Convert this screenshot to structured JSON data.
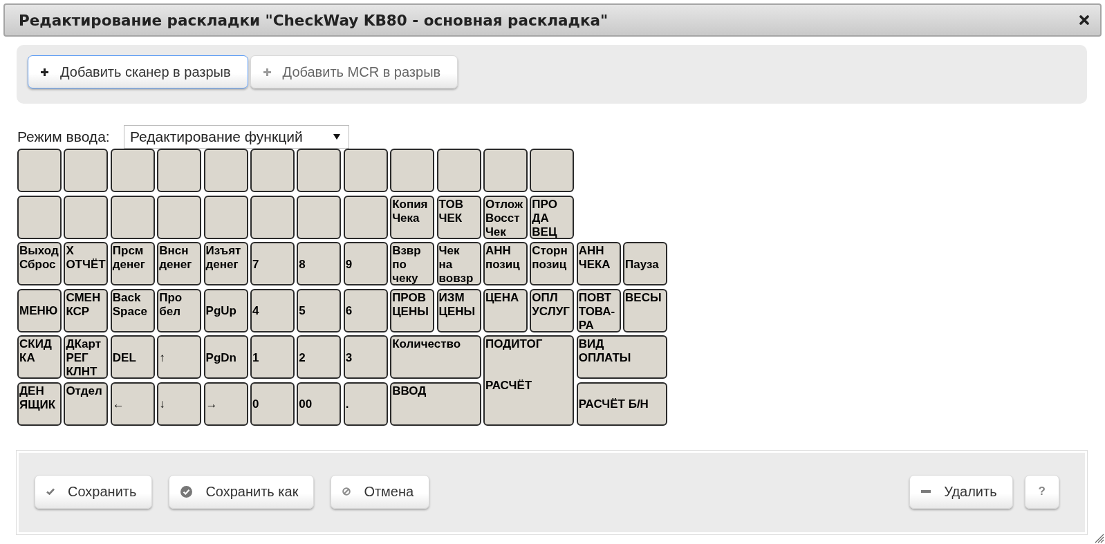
{
  "window": {
    "title": "Редактирование раскладки \"CheckWay KB80 - основная раскладка\""
  },
  "toolbar": {
    "buttons": [
      {
        "label": "Добавить сканер в разрыв",
        "focused": true,
        "disabled": false
      },
      {
        "label": "Добавить MCR в разрыв",
        "focused": false,
        "disabled": true
      }
    ]
  },
  "input_mode": {
    "label": "Режим ввода:",
    "value": "Редактирование функций"
  },
  "keyboard": {
    "rows": [
      [
        {},
        {},
        {},
        {},
        {},
        {},
        {},
        {},
        {},
        {},
        {},
        {}
      ],
      [
        {},
        {},
        {},
        {},
        {},
        {},
        {},
        {},
        {
          "label": "Копия\nЧека"
        },
        {
          "label": "ТОВ\nЧЕК"
        },
        {
          "label": "Отлож\nВосст\nЧек"
        },
        {
          "label": "ПРО\nДА\nВЕЦ"
        }
      ],
      [
        {
          "label": "Выход\nСброс"
        },
        {
          "label": "Х\nОТЧЁТ"
        },
        {
          "label": "Прсм\nденег"
        },
        {
          "label": "Внсн\nденег"
        },
        {
          "label": "Изъят\nденег"
        },
        {
          "label": "7"
        },
        {
          "label": "8"
        },
        {
          "label": "9"
        },
        {
          "label": "Взвр\nпо\nчеку"
        },
        {
          "label": "Чек\nна\nвовзр"
        },
        {
          "label": "АНН\nпозиц"
        },
        {
          "label": "Сторн\nпозиц"
        },
        {
          "label": "АНН\nЧЕКА"
        },
        {
          "label": "Пауза"
        }
      ],
      [
        {
          "label": "МЕНЮ"
        },
        {
          "label": "СМЕН\nКСР"
        },
        {
          "label": "Back\nSpace"
        },
        {
          "label": "Про\nбел"
        },
        {
          "label": "PgUp"
        },
        {
          "label": "4"
        },
        {
          "label": "5"
        },
        {
          "label": "6"
        },
        {
          "label": "ПРОВ\nЦЕНЫ"
        },
        {
          "label": "ИЗМ\nЦЕНЫ"
        },
        {
          "label": "ЦЕНА\n"
        },
        {
          "label": "ОПЛ\nУСЛУГ"
        },
        {
          "label": "ПОВТ\nТОВА-\nРА"
        },
        {
          "label": "ВЕСЫ\n"
        }
      ],
      [
        {
          "label": "СКИД\nКА"
        },
        {
          "label": "ДКарт\nРЕГ\nКЛНТ"
        },
        {
          "label": "DEL"
        },
        {
          "label": "↑"
        },
        {
          "label": "PgDn"
        },
        {
          "label": "1"
        },
        {
          "label": "2"
        },
        {
          "label": "3"
        },
        {
          "label": "Количество\n",
          "colspan": 2
        },
        {
          "label": "ПОДИТОГ\n\n\nРАСЧЁТ",
          "colspan": 2,
          "rowspan": 2
        },
        {
          "label": "ВИД\nОПЛАТЫ",
          "colspan": 2
        }
      ],
      [
        {
          "label": "ДЕН\nЯЩИК"
        },
        {
          "label": "Отдел\n"
        },
        {
          "label": "←"
        },
        {
          "label": "↓"
        },
        {
          "label": "→"
        },
        {
          "label": "0"
        },
        {
          "label": "00"
        },
        {
          "label": "."
        },
        {
          "label": "ВВОД\n",
          "colspan": 2
        },
        {
          "label": "РАСЧЁТ Б/Н",
          "colspan": 2
        }
      ]
    ]
  },
  "footer": {
    "left_buttons": [
      "Сохранить",
      "Сохранить как",
      "Отмена"
    ],
    "right_buttons": [
      "Удалить",
      "?"
    ]
  }
}
